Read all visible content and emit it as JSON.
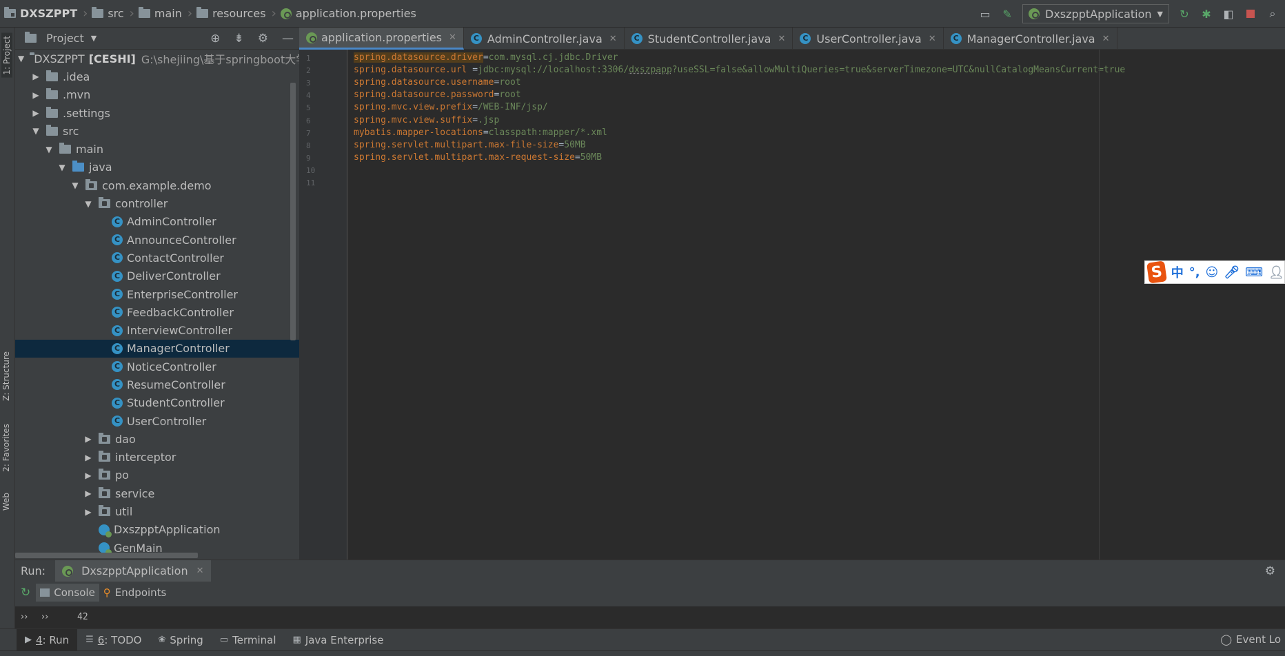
{
  "breadcrumb": {
    "project": "DXSZPPT",
    "items": [
      "src",
      "main",
      "resources"
    ],
    "file": "application.properties"
  },
  "toolbar": {
    "run_config": "DxszpptApplication"
  },
  "left_stripe": {
    "project_tab": "1: Project",
    "structure_tab": "Z: Structure",
    "favorites_tab": "2: Favorites",
    "web_tab": "Web"
  },
  "project_panel": {
    "title": "Project",
    "root_name": "DXSZPPT",
    "root_module": "[CESHI]",
    "root_path": "G:\\shejiing\\基于springboot大学",
    "tree": [
      {
        "label": ".idea",
        "level": 1,
        "kind": "folder",
        "expanded": false
      },
      {
        "label": ".mvn",
        "level": 1,
        "kind": "folder",
        "expanded": false
      },
      {
        "label": ".settings",
        "level": 1,
        "kind": "folder",
        "expanded": false
      },
      {
        "label": "src",
        "level": 1,
        "kind": "folder",
        "expanded": true
      },
      {
        "label": "main",
        "level": 2,
        "kind": "folder",
        "expanded": true
      },
      {
        "label": "java",
        "level": 3,
        "kind": "java",
        "expanded": true
      },
      {
        "label": "com.example.demo",
        "level": 4,
        "kind": "pkg",
        "expanded": true
      },
      {
        "label": "controller",
        "level": 5,
        "kind": "pkg",
        "expanded": true
      },
      {
        "label": "AdminController",
        "level": 6,
        "kind": "class"
      },
      {
        "label": "AnnounceController",
        "level": 6,
        "kind": "class"
      },
      {
        "label": "ContactController",
        "level": 6,
        "kind": "class"
      },
      {
        "label": "DeliverController",
        "level": 6,
        "kind": "class"
      },
      {
        "label": "EnterpriseController",
        "level": 6,
        "kind": "class"
      },
      {
        "label": "FeedbackController",
        "level": 6,
        "kind": "class"
      },
      {
        "label": "InterviewController",
        "level": 6,
        "kind": "class"
      },
      {
        "label": "ManagerController",
        "level": 6,
        "kind": "class",
        "selected": true
      },
      {
        "label": "NoticeController",
        "level": 6,
        "kind": "class"
      },
      {
        "label": "ResumeController",
        "level": 6,
        "kind": "class"
      },
      {
        "label": "StudentController",
        "level": 6,
        "kind": "class"
      },
      {
        "label": "UserController",
        "level": 6,
        "kind": "class"
      },
      {
        "label": "dao",
        "level": 5,
        "kind": "pkg",
        "expanded": false
      },
      {
        "label": "interceptor",
        "level": 5,
        "kind": "pkg",
        "expanded": false
      },
      {
        "label": "po",
        "level": 5,
        "kind": "pkg",
        "expanded": false
      },
      {
        "label": "service",
        "level": 5,
        "kind": "pkg",
        "expanded": false
      },
      {
        "label": "util",
        "level": 5,
        "kind": "pkg",
        "expanded": false
      },
      {
        "label": "DxszpptApplication",
        "level": 5,
        "kind": "spring"
      },
      {
        "label": "GenMain",
        "level": 5,
        "kind": "spring"
      }
    ]
  },
  "editor": {
    "tabs": [
      {
        "label": "application.properties",
        "kind": "properties",
        "active": true
      },
      {
        "label": "AdminController.java",
        "kind": "class"
      },
      {
        "label": "StudentController.java",
        "kind": "class"
      },
      {
        "label": "UserController.java",
        "kind": "class"
      },
      {
        "label": "ManagerController.java",
        "kind": "class"
      }
    ],
    "lines": [
      {
        "key": "spring.datasource.driver",
        "sep": "=",
        "value": "com.mysql.cj.jdbc.Driver",
        "highlight": true
      },
      {
        "key": "spring.datasource.url ",
        "sep": "=",
        "value": "jdbc:mysql://localhost:3306/dxszpapp?useSSL=false&allowMultiQueries=true&serverTimezone=UTC&nullCatalogMeansCurrent=true"
      },
      {
        "key": "spring.datasource.username",
        "sep": "=",
        "value": "root"
      },
      {
        "key": "spring.datasource.password",
        "sep": "=",
        "value": "root"
      },
      {
        "key": "spring.mvc.view.prefix",
        "sep": "=",
        "value": "/WEB-INF/jsp/"
      },
      {
        "key": "spring.mvc.view.suffix",
        "sep": "=",
        "value": ".jsp"
      },
      {
        "key": "mybatis.mapper-locations",
        "sep": "=",
        "value": "classpath:mapper/*.xml"
      },
      {
        "key": "spring.servlet.multipart.max-file-size",
        "sep": "=",
        "value": "50MB"
      },
      {
        "key": "spring.servlet.multipart.max-request-size",
        "sep": "=",
        "value": "50MB"
      },
      {
        "key": "",
        "sep": "",
        "value": ""
      },
      {
        "key": "",
        "sep": "",
        "value": ""
      }
    ],
    "line_numbers": [
      "1",
      "2",
      "3",
      "4",
      "5",
      "6",
      "7",
      "8",
      "9",
      "10",
      "11"
    ]
  },
  "ime": {
    "logo": "S",
    "lang": "中",
    "punct": "°,"
  },
  "run_panel": {
    "label": "Run:",
    "tab": "DxszpptApplication",
    "subtabs": [
      "Console",
      "Endpoints"
    ],
    "console_output": "42"
  },
  "bottom_bar": {
    "tabs": [
      {
        "num": "4",
        "label": ": Run",
        "active": true
      },
      {
        "num": "6",
        "label": ": TODO"
      },
      {
        "num": "",
        "label": "Spring"
      },
      {
        "num": "",
        "label": "Terminal"
      },
      {
        "num": "",
        "label": "Java Enterprise"
      }
    ],
    "event_log": "Event Lo"
  }
}
